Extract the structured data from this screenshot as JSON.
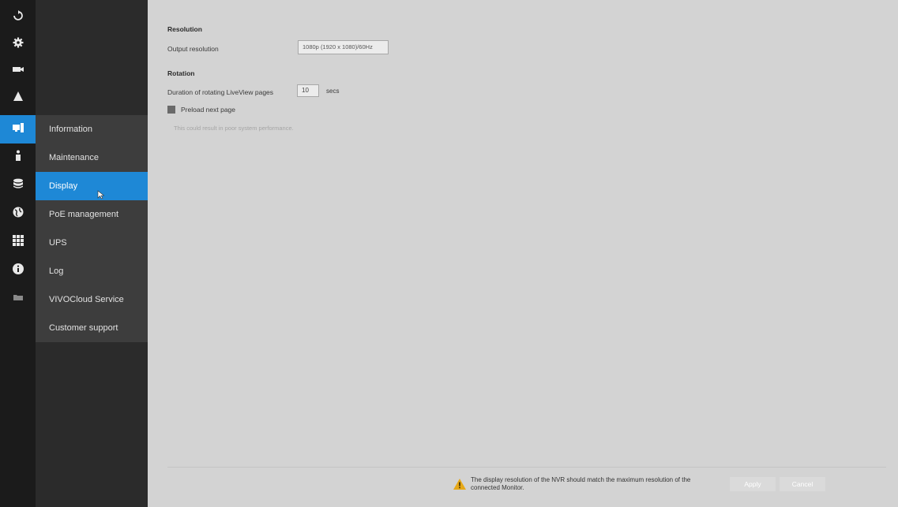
{
  "rail": {
    "items": [
      {
        "name": "logout-icon"
      },
      {
        "name": "gear-icon"
      },
      {
        "name": "camera-icon"
      },
      {
        "name": "alarm-icon"
      },
      {
        "name": "system-icon",
        "active": true
      },
      {
        "name": "user-icon"
      },
      {
        "name": "storage-icon"
      },
      {
        "name": "network-icon"
      },
      {
        "name": "apps-grid-icon"
      },
      {
        "name": "info-icon"
      },
      {
        "name": "folder-icon"
      }
    ]
  },
  "submenu": {
    "items": [
      {
        "label": "Information"
      },
      {
        "label": "Maintenance"
      },
      {
        "label": "Display",
        "active": true
      },
      {
        "label": "PoE management"
      },
      {
        "label": "UPS"
      },
      {
        "label": "Log"
      },
      {
        "label": "VIVOCloud Service"
      },
      {
        "label": "Customer support"
      }
    ]
  },
  "main": {
    "resolution": {
      "section_title": "Resolution",
      "output_label": "Output resolution",
      "output_value": "1080p (1920 x 1080)/60Hz"
    },
    "rotation": {
      "section_title": "Rotation",
      "duration_label": "Duration of rotating LiveView pages",
      "duration_value": "10",
      "duration_unit": "secs",
      "preload_label": "Preload next page",
      "preload_checked": false,
      "note": "This could result in poor system performance."
    },
    "footer": {
      "warning": "The display resolution of the NVR should match the maximum resolution of the connected Monitor.",
      "apply_label": "Apply",
      "cancel_label": "Cancel"
    }
  },
  "colors": {
    "accent": "#1e88d6",
    "rail_bg": "#1b1b1b",
    "submenu_bg": "#3d3d3d",
    "content_bg": "#d3d3d3",
    "warning": "#e6a817"
  }
}
